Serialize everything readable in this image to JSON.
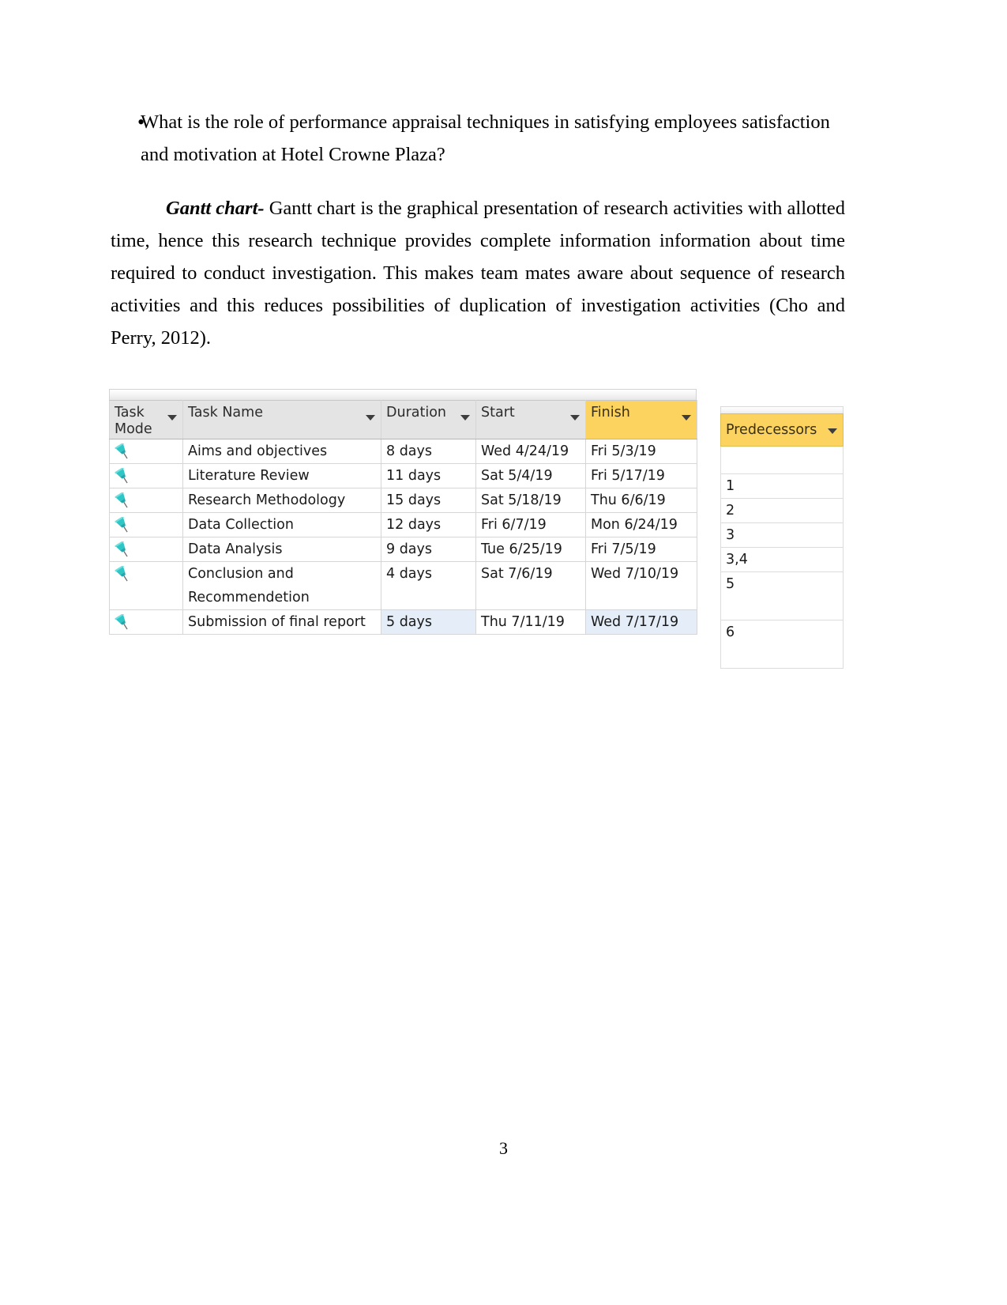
{
  "document": {
    "bullet": {
      "marker": "•",
      "text": "What is the role of performance appraisal techniques in satisfying employees satisfaction and motivation at Hotel Crowne Plaza?"
    },
    "gantt_paragraph": {
      "lead": "Gantt chart-",
      "body": " Gantt chart is the graphical presentation of research activities with allotted time, hence this research technique provides complete information information about time required to conduct investigation. This makes team mates aware about sequence of research activities and this reduces possibilities of duplication of investigation activities (Cho and Perry, 2012)."
    },
    "page_number": "3"
  },
  "colors": {
    "header_background": "#e4e4e4",
    "highlight_yellow": "#fbd35e",
    "selection_blue": "#e5eef8",
    "pin_teal": "#2fc6c6",
    "grid_line": "#d6d6d6"
  },
  "gantt_table": {
    "columns": [
      {
        "id": "task_mode",
        "label": "Task Mode",
        "has_filter": true
      },
      {
        "id": "task_name",
        "label": "Task Name",
        "has_filter": true
      },
      {
        "id": "duration",
        "label": "Duration",
        "has_filter": true
      },
      {
        "id": "start",
        "label": "Start",
        "has_filter": true
      },
      {
        "id": "finish",
        "label": "Finish",
        "has_filter": true,
        "highlighted": true
      }
    ],
    "rows": [
      {
        "mode_icon": "pushpin-icon",
        "task_name": "Aims and objectives",
        "duration": "8 days",
        "start": "Wed 4/24/19",
        "finish": "Fri 5/3/19",
        "selected": false,
        "tall": false
      },
      {
        "mode_icon": "pushpin-icon",
        "task_name": "Literature Review",
        "duration": "11 days",
        "start": "Sat 5/4/19",
        "finish": "Fri 5/17/19",
        "selected": false,
        "tall": false
      },
      {
        "mode_icon": "pushpin-icon",
        "task_name": "Research Methodology",
        "duration": "15 days",
        "start": "Sat 5/18/19",
        "finish": "Thu 6/6/19",
        "selected": false,
        "tall": false
      },
      {
        "mode_icon": "pushpin-icon",
        "task_name": "Data Collection",
        "duration": "12 days",
        "start": "Fri 6/7/19",
        "finish": "Mon 6/24/19",
        "selected": false,
        "tall": false
      },
      {
        "mode_icon": "pushpin-icon",
        "task_name": "Data Analysis",
        "duration": "9 days",
        "start": "Tue 6/25/19",
        "finish": "Fri 7/5/19",
        "selected": false,
        "tall": false
      },
      {
        "mode_icon": "pushpin-icon",
        "task_name": "Conclusion and Recommendetion",
        "duration": "4 days",
        "start": "Sat 7/6/19",
        "finish": "Wed 7/10/19",
        "selected": false,
        "tall": true
      },
      {
        "mode_icon": "pushpin-icon",
        "task_name": "Submission of final report",
        "duration": "5 days",
        "start": "Thu 7/11/19",
        "finish": "Wed 7/17/19",
        "selected": true,
        "tall": true
      }
    ]
  },
  "predecessors_panel": {
    "header": {
      "label": "Predecessors",
      "has_filter": true,
      "highlighted": true
    },
    "values": [
      "",
      "1",
      "2",
      "3",
      "3,4",
      "5",
      "6"
    ]
  }
}
